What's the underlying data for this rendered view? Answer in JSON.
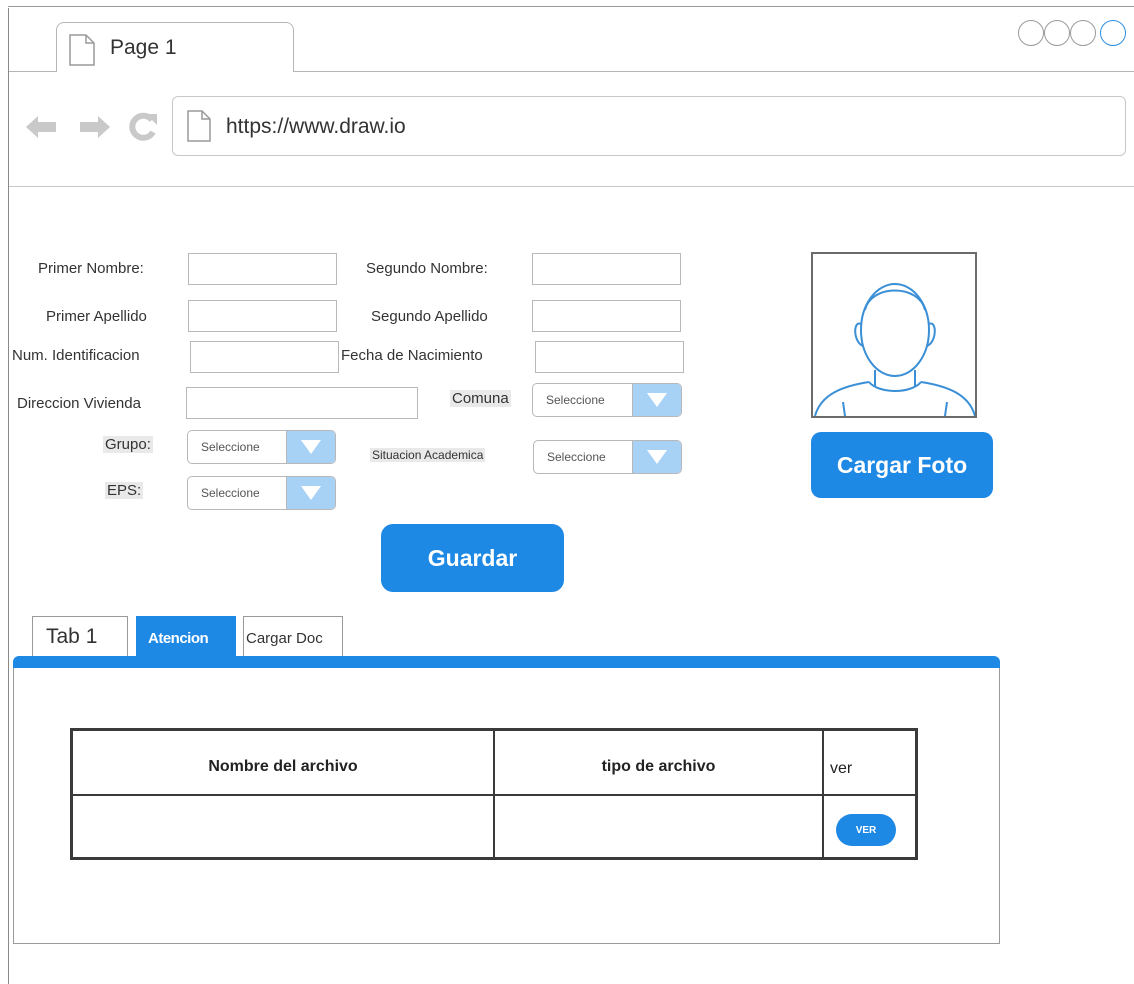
{
  "browser": {
    "tab_title": "Page 1",
    "url": "https://www.draw.io",
    "nav_icons": [
      "back-arrow-icon",
      "forward-arrow-icon",
      "reload-icon",
      "page-icon"
    ]
  },
  "form": {
    "primer_nombre_label": "Primer Nombre:",
    "segundo_nombre_label": "Segundo Nombre:",
    "primer_apellido_label": "Primer Apellido",
    "segundo_apellido_label": "Segundo Apellido",
    "num_identificacion_label": "Num. Identificacion",
    "fecha_nacimiento_label": "Fecha de Nacimiento",
    "direccion_label": "Direccion Vivienda",
    "comuna_label": "Comuna",
    "grupo_label": "Grupo:",
    "situacion_label": "Situacion Academica",
    "eps_label": "EPS:",
    "select_placeholder": "Seleccione",
    "save_button": "Guardar"
  },
  "photo": {
    "upload_button": "Cargar Foto"
  },
  "tabs": [
    {
      "label": "Tab 1"
    },
    {
      "label": "Atencion"
    },
    {
      "label": "Cargar Doc"
    }
  ],
  "table": {
    "headers": [
      "Nombre del archivo",
      "tipo de archivo",
      "ver"
    ],
    "row_button": "VER"
  },
  "colors": {
    "accent": "#1e88e5",
    "select_arrow": "#a8d1f6"
  }
}
